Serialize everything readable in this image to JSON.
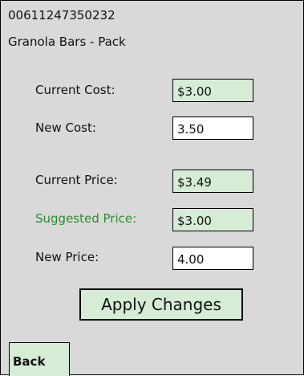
{
  "header": {
    "barcode": "00611247350232",
    "product_name": "Granola Bars - Pack"
  },
  "form": {
    "current_cost_label": "Current Cost:",
    "current_cost_value": "$3.00",
    "new_cost_label": "New Cost:",
    "new_cost_value": "3.50",
    "current_price_label": "Current Price:",
    "current_price_value": "$3.49",
    "suggested_price_label": "Suggested Price:",
    "suggested_price_value": "$3.00",
    "new_price_label": "New Price:",
    "new_price_value": "4.00"
  },
  "actions": {
    "apply_label": "Apply Changes",
    "back_label": "Back"
  },
  "colors": {
    "background": "#d9d9d9",
    "field_readonly": "#d6ecd6",
    "suggested_label": "#2e8b2e"
  }
}
